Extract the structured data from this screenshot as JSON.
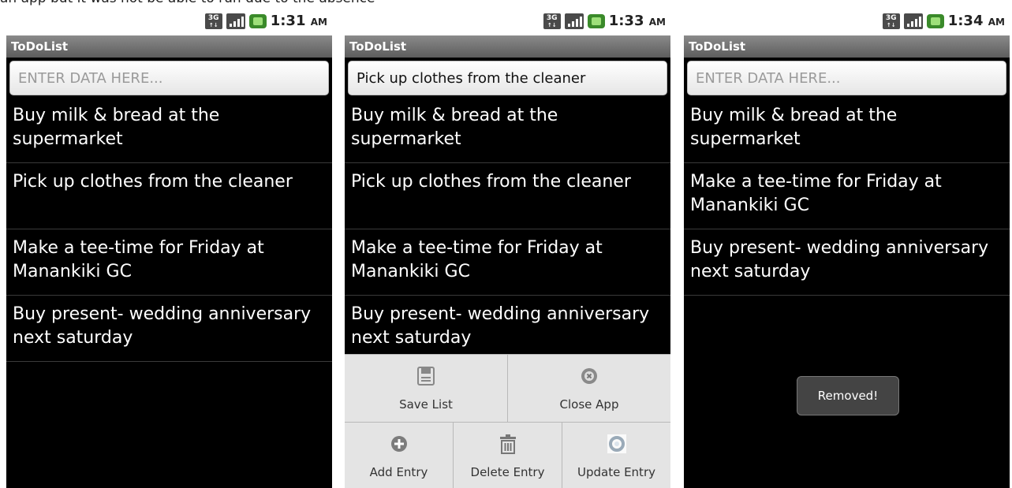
{
  "caption": "an app but it was not be able to run due to the absence",
  "screens": [
    {
      "status_time": "1:31",
      "status_ampm": "AM",
      "app_title": "ToDoList",
      "entry_value": "",
      "entry_placeholder": "ENTER DATA HERE...",
      "items": [
        "Buy milk & bread at the supermarket",
        "Pick up clothes from the cleaner",
        "Make a tee-time for Friday at Manankiki GC",
        "Buy present- wedding anniversary next saturday"
      ]
    },
    {
      "status_time": "1:33",
      "status_ampm": "AM",
      "app_title": "ToDoList",
      "entry_value": "Pick up clothes from the cleaner",
      "entry_placeholder": "ENTER DATA HERE...",
      "items": [
        "Buy milk & bread at the supermarket",
        "Pick up clothes from the cleaner",
        "Make a tee-time for Friday at Manankiki GC",
        "Buy present- wedding anniversary next saturday"
      ],
      "menu": {
        "save_list": "Save List",
        "close_app": "Close App",
        "add_entry": "Add Entry",
        "delete_entry": "Delete Entry",
        "update_entry": "Update Entry"
      }
    },
    {
      "status_time": "1:34",
      "status_ampm": "AM",
      "app_title": "ToDoList",
      "entry_value": "",
      "entry_placeholder": "ENTER DATA HERE...",
      "items": [
        "Buy milk & bread at the supermarket",
        "Make a tee-time for Friday at Manankiki GC",
        "Buy present- wedding anniversary next saturday"
      ],
      "toast": "Removed!"
    }
  ],
  "status_icons": {
    "network": "3G",
    "network_arrows": "↑↓"
  },
  "icons": [
    "3g-icon",
    "signal-icon",
    "battery-icon",
    "save-icon",
    "close-icon",
    "add-icon",
    "delete-icon",
    "update-icon"
  ]
}
